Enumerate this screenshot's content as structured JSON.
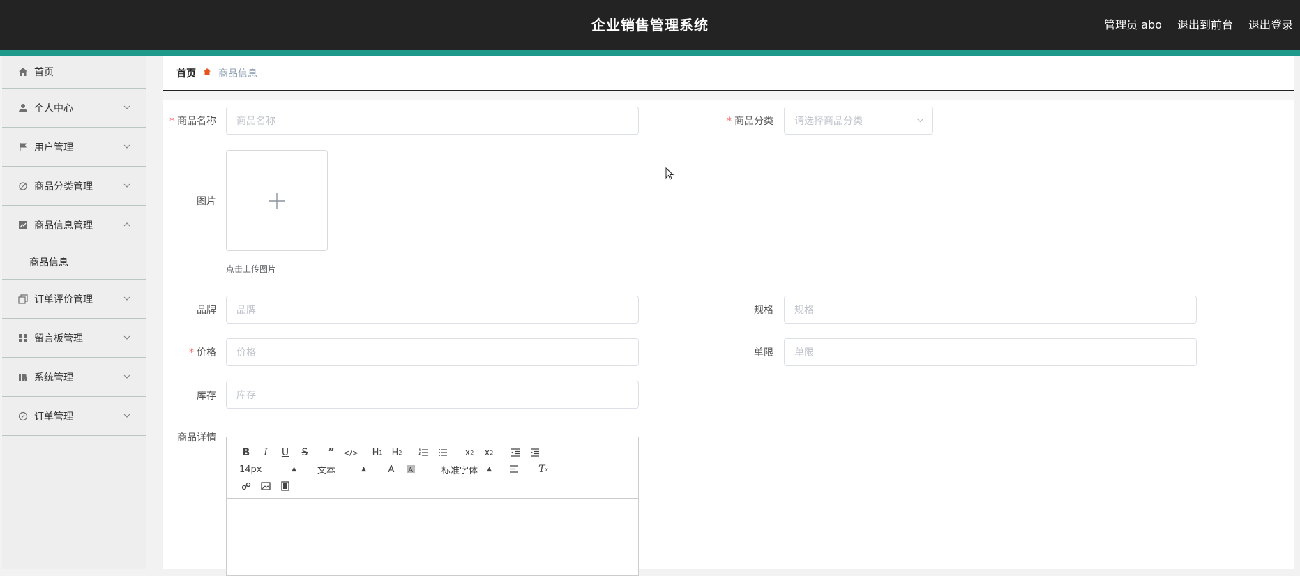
{
  "header": {
    "title": "企业销售管理系统",
    "admin": "管理员 abo",
    "to_front": "退出到前台",
    "logout": "退出登录"
  },
  "sidebar": {
    "items": [
      {
        "label": "首页",
        "icon": "home-icon"
      },
      {
        "label": "个人中心",
        "icon": "user-icon"
      },
      {
        "label": "用户管理",
        "icon": "flag-icon"
      },
      {
        "label": "商品分类管理",
        "icon": "disabled-icon"
      },
      {
        "label": "商品信息管理",
        "icon": "chart-icon"
      },
      {
        "label": "订单评价管理",
        "icon": "copy-icon"
      },
      {
        "label": "留言板管理",
        "icon": "grid-icon"
      },
      {
        "label": "系统管理",
        "icon": "library-icon"
      },
      {
        "label": "订单管理",
        "icon": "compass-icon"
      }
    ],
    "subitem": "商品信息"
  },
  "breadcrumb": {
    "home": "首页",
    "current": "商品信息"
  },
  "form": {
    "name_label": "商品名称",
    "name_placeholder": "商品名称",
    "category_label": "商品分类",
    "category_placeholder": "请选择商品分类",
    "image_label": "图片",
    "upload_tip": "点击上传图片",
    "brand_label": "品牌",
    "brand_placeholder": "品牌",
    "spec_label": "规格",
    "spec_placeholder": "规格",
    "price_label": "价格",
    "price_placeholder": "价格",
    "limit_label": "单限",
    "limit_placeholder": "单限",
    "stock_label": "库存",
    "stock_placeholder": "库存",
    "detail_label": "商品详情"
  },
  "editor": {
    "size": "14px",
    "header": "文本",
    "font": "标准字体"
  },
  "colors": {
    "topbar": "#232323",
    "accent": "#1f9a8a",
    "required": "#f56c6c"
  }
}
